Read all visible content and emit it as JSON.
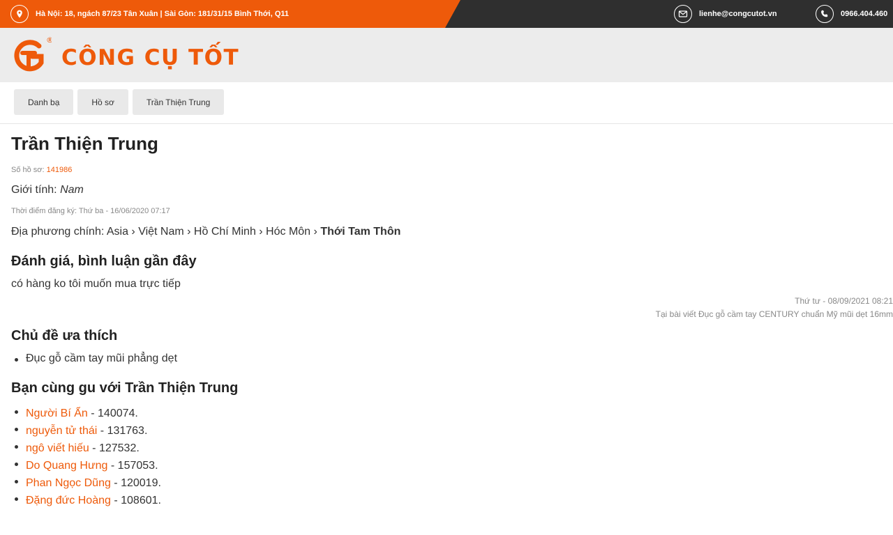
{
  "topbar": {
    "address": "Hà Nội: 18, ngách 87/23 Tân Xuân | Sài Gòn: 181/31/15 Bình Thới, Q11",
    "email": "lienhe@congcutot.vn",
    "phone": "0966.404.460",
    "icons": {
      "address": "location-pin-icon",
      "email": "envelope-icon",
      "phone": "phone-icon"
    }
  },
  "header": {
    "logo_text": "CÔNG CỤ TỐT",
    "logo_mark": "®"
  },
  "breadcrumb": [
    "Danh bạ",
    "Hồ sơ",
    "Trần Thiện Trung"
  ],
  "profile": {
    "name": "Trần Thiện Trung",
    "id_label": "Số hồ sơ:",
    "id_value": "141986",
    "gender_label": "Giới tính:",
    "gender_value": "Nam",
    "registered": "Thời điểm đăng ký: Thứ ba - 16/06/2020 07:17",
    "location_label": "Địa phương chính:",
    "location_path": "Asia › Việt Nam › Hồ Chí Minh › Hóc Môn ›",
    "location_last": "Thới Tam Thôn"
  },
  "reviews": {
    "heading": "Đánh giá, bình luận gần đây",
    "comment": "có hàng ko tôi muốn mua trực tiếp",
    "time": "Thứ tư - 08/09/2021 08:21",
    "source": "Tại bài viết Đục gỗ cầm tay CENTURY chuẩn Mỹ mũi dẹt 16mm"
  },
  "favorites": {
    "heading": "Chủ đề ưa thích",
    "items": [
      "Đục gỗ cầm tay mũi phẳng dẹt"
    ]
  },
  "similar": {
    "heading": "Bạn cùng gu với Trần Thiện Trung",
    "items": [
      {
        "name": "Người Bí Ẩn",
        "suffix": " - 140074."
      },
      {
        "name": "nguyễn tử thái",
        "suffix": " - 131763."
      },
      {
        "name": "ngô viết hiếu",
        "suffix": " - 127532."
      },
      {
        "name": "Do Quang Hưng",
        "suffix": " - 157053."
      },
      {
        "name": "Phan Ngọc Dũng",
        "suffix": " - 120019."
      },
      {
        "name": "Đặng đức Hoàng",
        "suffix": " - 108601."
      }
    ]
  },
  "colors": {
    "brand": "#ee5a0a",
    "topbar_dark": "#2f2f2f",
    "header_bg": "#ececec"
  }
}
